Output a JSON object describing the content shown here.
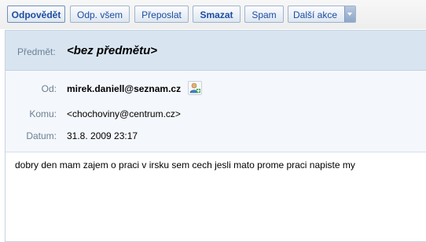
{
  "toolbar": {
    "reply": "Odpovědět",
    "reply_all": "Odp. všem",
    "forward": "Přeposlat",
    "delete": "Smazat",
    "spam": "Spam",
    "more": "Další akce"
  },
  "message": {
    "subject_label": "Předmět:",
    "subject": "<bez předmětu>",
    "from_label": "Od:",
    "from": "mirek.daniell@seznam.cz",
    "to_label": "Komu:",
    "to": "<chochoviny@centrum.cz>",
    "date_label": "Datum:",
    "date": "31.8. 2009 23:17",
    "body": "dobry den mam zajem o praci v irsku sem cech jesli mato prome praci napiste my"
  },
  "icons": {
    "add_contact": "add-contact-icon",
    "dropdown": "chevron-down-icon"
  },
  "colors": {
    "accent_text": "#1d4ea0",
    "subject_bar": "#d8e5f1",
    "header_bg": "#f4f7fb",
    "label_text": "#6c7f93"
  }
}
